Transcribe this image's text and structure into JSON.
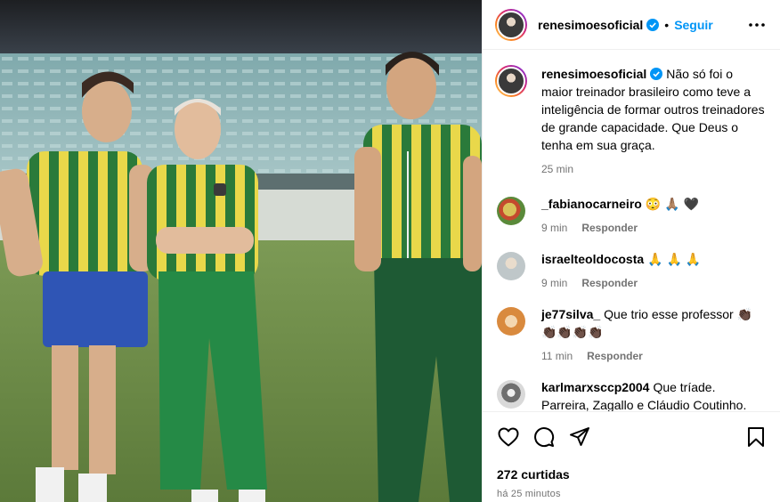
{
  "post": {
    "username": "renesimoesoficial",
    "follow_label": "Seguir",
    "separator": "•"
  },
  "caption": {
    "username": "renesimoesoficial",
    "text": "Não só foi o maior treinador brasileiro como teve a inteligência de formar outros treinadores de grande capacidade. Que Deus o tenha em sua graça.",
    "time": "25 min"
  },
  "comments": [
    {
      "username": "_fabianocarneiro",
      "text": "😳 🙏🏽 🖤",
      "time": "9 min",
      "reply": "Responder"
    },
    {
      "username": "israelteoldocosta",
      "text": "🙏 🙏 🙏",
      "time": "9 min",
      "reply": "Responder"
    },
    {
      "username": "je77silva_",
      "text": "Que trio esse professor 👏🏿👏🏿👏🏿👏🏿👏🏿",
      "time": "11 min",
      "reply": "Responder"
    },
    {
      "username": "karlmarxsccp2004",
      "text": "Que tríade. Parreira, Zagallo e Cláudio Coutinho.",
      "time": "",
      "reply": ""
    }
  ],
  "stats": {
    "likes": "272 curtidas",
    "posted": "há 25 minutos"
  },
  "colors": {
    "accent": "#0095f6",
    "secondary_text": "#737373",
    "verified": "#0095f6"
  },
  "icons": [
    "verified-badge-icon",
    "more-options-icon",
    "heart-icon",
    "comment-icon",
    "share-icon",
    "bookmark-icon"
  ]
}
